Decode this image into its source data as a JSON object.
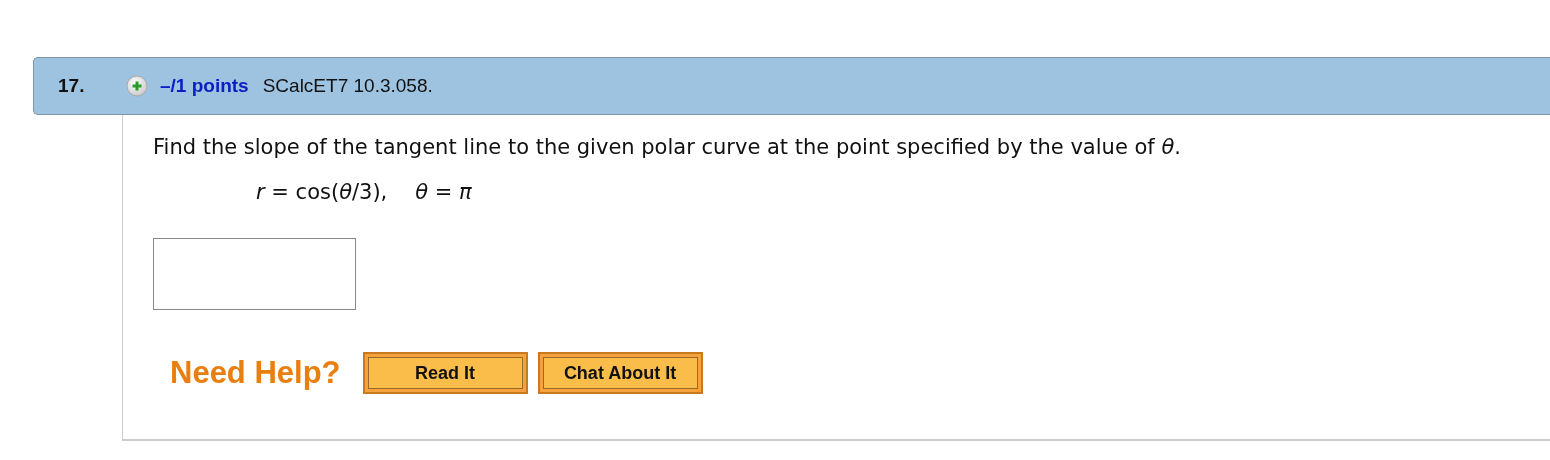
{
  "question": {
    "number": "17.",
    "points": "–/1 points",
    "source": "SCalcET7 10.3.058.",
    "prompt": "Find the slope of the tangent line to the given polar curve at the point specified by the value of *θ*.",
    "equations": [
      "*r* = cos(*θ*/3),",
      "*θ* = *π*"
    ],
    "help": {
      "label": "Need Help?",
      "buttons": [
        "Read It",
        "Chat About It"
      ]
    }
  }
}
